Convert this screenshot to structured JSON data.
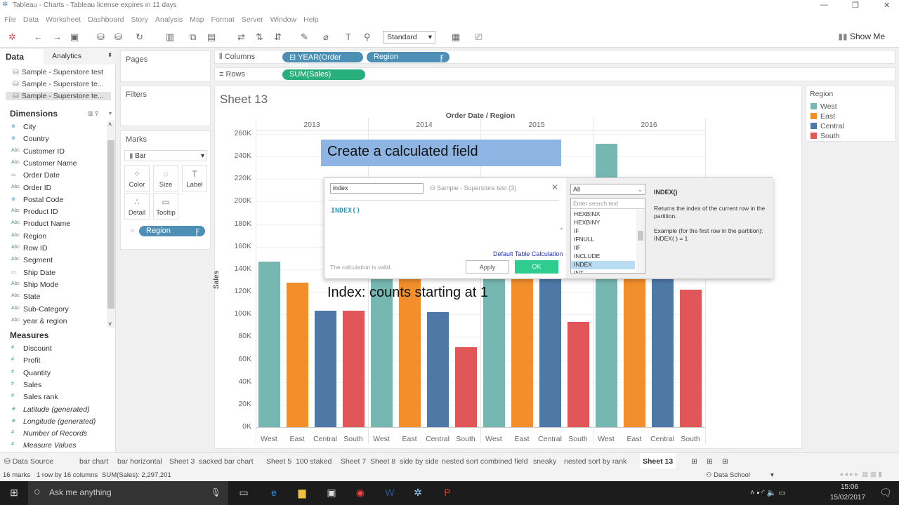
{
  "window": {
    "title": "Tableau - Charts - Tableau license expires in 11 days"
  },
  "menu": [
    "File",
    "Data",
    "Worksheet",
    "Dashboard",
    "Story",
    "Analysis",
    "Map",
    "Format",
    "Server",
    "Window",
    "Help"
  ],
  "toolbar": {
    "fit_select": "Standard",
    "show_me": "Show Me"
  },
  "left_panel": {
    "tabs": [
      "Data",
      "Analytics"
    ],
    "data_sources": [
      "Sample - Superstore test",
      "Sample - Superstore te...",
      "Sample - Superstore te..."
    ],
    "dimensions_header": "Dimensions",
    "dimensions": [
      {
        "icon": "globe",
        "label": "City"
      },
      {
        "icon": "globe",
        "label": "Country"
      },
      {
        "icon": "Abc",
        "label": "Customer ID"
      },
      {
        "icon": "Abc",
        "label": "Customer Name"
      },
      {
        "icon": "calendar",
        "label": "Order Date"
      },
      {
        "icon": "Abc",
        "label": "Order ID"
      },
      {
        "icon": "globe",
        "label": "Postal Code"
      },
      {
        "icon": "Abc",
        "label": "Product ID"
      },
      {
        "icon": "Abc",
        "label": "Product Name"
      },
      {
        "icon": "Abc",
        "label": "Region"
      },
      {
        "icon": "Abc",
        "label": "Row ID"
      },
      {
        "icon": "Abc",
        "label": "Segment"
      },
      {
        "icon": "calendar",
        "label": "Ship Date"
      },
      {
        "icon": "Abc",
        "label": "Ship Mode"
      },
      {
        "icon": "Abc",
        "label": "State"
      },
      {
        "icon": "Abc",
        "label": "Sub-Category"
      },
      {
        "icon": "Abc",
        "label": "year & region"
      }
    ],
    "measures_header": "Measures",
    "measures": [
      {
        "icon": "#",
        "label": "Discount"
      },
      {
        "icon": "#",
        "label": "Profit"
      },
      {
        "icon": "#",
        "label": "Quantity"
      },
      {
        "icon": "#",
        "label": "Sales"
      },
      {
        "icon": "#",
        "label": "Sales rank"
      },
      {
        "icon": "globe",
        "label": "Latitude (generated)",
        "italic": true
      },
      {
        "icon": "globe",
        "label": "Longitude (generated)",
        "italic": true
      },
      {
        "icon": "#",
        "label": "Number of Records",
        "italic": true
      },
      {
        "icon": "#",
        "label": "Measure Values",
        "italic": true
      }
    ]
  },
  "cards": {
    "pages": "Pages",
    "filters": "Filters",
    "marks": "Marks",
    "mark_type": "Bar",
    "mark_buttons": [
      "Color",
      "Size",
      "Label",
      "Detail",
      "Tooltip"
    ],
    "color_pill": "Region"
  },
  "shelves": {
    "columns_label": "Columns",
    "rows_label": "Rows",
    "columns": [
      "YEAR(Order Date)",
      "Region"
    ],
    "rows": [
      "SUM(Sales)"
    ]
  },
  "sheet": {
    "title": "Sheet 13"
  },
  "legend": {
    "title": "Region",
    "items": [
      {
        "label": "West",
        "color": "#76b7b2"
      },
      {
        "label": "East",
        "color": "#f28e2b"
      },
      {
        "label": "Central",
        "color": "#4e79a7"
      },
      {
        "label": "South",
        "color": "#e15759"
      }
    ]
  },
  "chart_data": {
    "type": "bar",
    "title": "Order Date / Region",
    "ylabel": "Sales",
    "ylim": [
      0,
      260000
    ],
    "yticks": [
      "0K",
      "20K",
      "40K",
      "60K",
      "80K",
      "100K",
      "120K",
      "140K",
      "160K",
      "180K",
      "200K",
      "220K",
      "240K",
      "260K"
    ],
    "years": [
      "2013",
      "2014",
      "2015",
      "2016"
    ],
    "regions": [
      "West",
      "East",
      "Central",
      "South"
    ],
    "values": [
      [
        147000,
        128000,
        103000,
        103000
      ],
      [
        140000,
        156000,
        102000,
        71000
      ],
      [
        182000,
        181000,
        147000,
        93000
      ],
      [
        251000,
        213000,
        147000,
        122000
      ]
    ]
  },
  "annotations": {
    "top": "Create a calculated field",
    "bottom": "Index: counts starting at 1"
  },
  "dialog": {
    "name": "index",
    "source": "Sample - Superstore test (3)",
    "formula": "INDEX()",
    "default_calc": "Default Table Calculation",
    "valid": "The calculation is valid.",
    "apply": "Apply",
    "ok": "OK",
    "category": "All",
    "search_placeholder": "Enter search text",
    "functions": [
      "HEXBINX",
      "HEXBINY",
      "IF",
      "IFNULL",
      "IIF",
      "INCLUDE",
      "INDEX",
      "INT"
    ],
    "selected": "INDEX",
    "help_title": "INDEX()",
    "help_desc": "Returns the index of the current row in the partition.",
    "help_example": "Example (for the first row in the partition): INDEX( ) = 1"
  },
  "sheet_tabs": {
    "data_source": "Data Source",
    "tabs": [
      "bar chart",
      "bar horizontal",
      "Sheet 3",
      "sacked bar chart",
      "Sheet 5",
      "100 staked",
      "Sheet 7",
      "Sheet 8",
      "side by side",
      "nested sort combined field",
      "sneaky",
      "nested sort by rank",
      "Sheet 13"
    ],
    "active": "Sheet 13"
  },
  "status": {
    "marks": "16 marks",
    "rows": "1 row by 16 columns",
    "sum": "SUM(Sales): 2,297,201",
    "user": "Data School"
  },
  "taskbar": {
    "search": "Ask me anything",
    "time": "15:06",
    "date": "15/02/2017"
  }
}
